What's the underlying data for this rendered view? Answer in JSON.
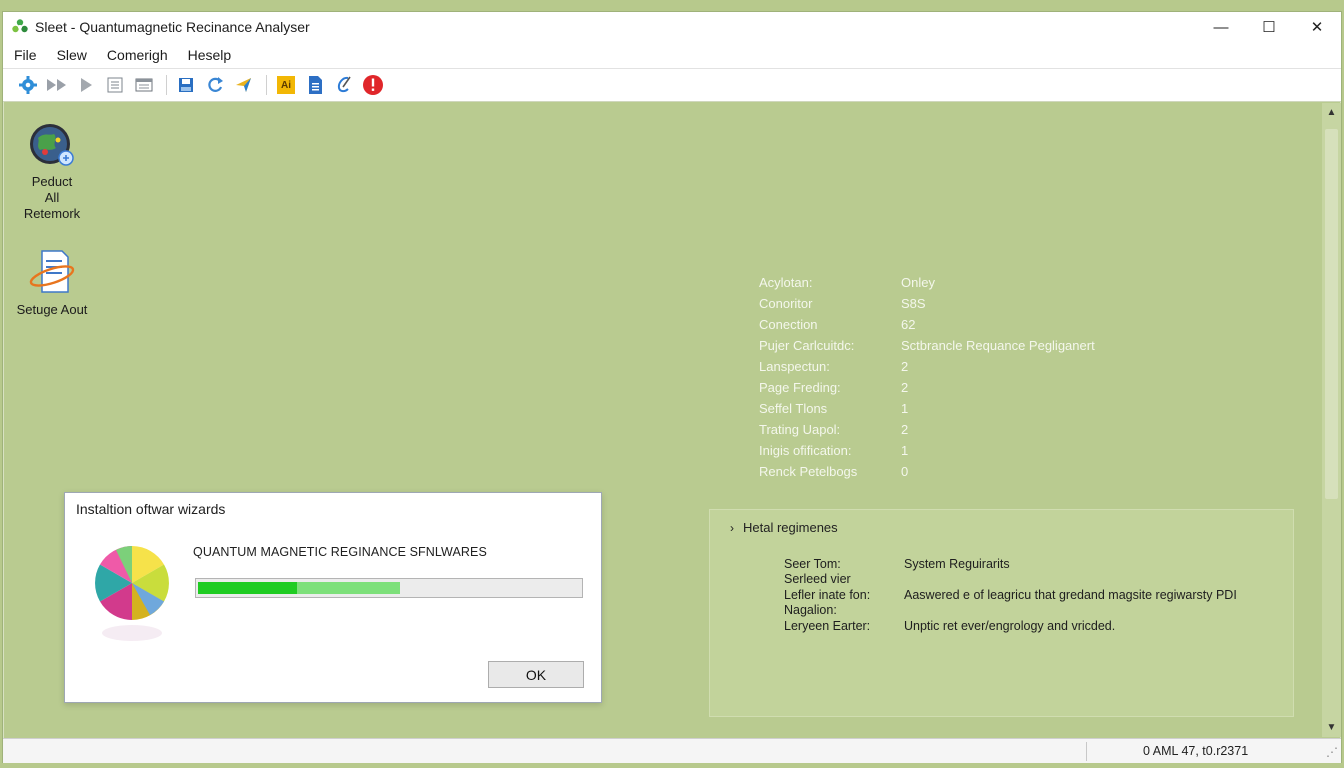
{
  "window": {
    "title": "Sleet - Quantumagnetic Recinance Analyser",
    "controls": {
      "minimize": "—",
      "maximize": "☐",
      "close": "✕"
    }
  },
  "menu": [
    "File",
    "Slew",
    "Comerigh",
    "Heselp"
  ],
  "toolbar": {
    "icons": [
      "settings-icon",
      "fast-forward-icon",
      "play-icon",
      "document-list-icon",
      "window-icon",
      "save-icon",
      "refresh-icon",
      "navigate-icon",
      "text-icon",
      "document-icon",
      "edit-icon",
      "error-icon"
    ],
    "text_icon_label": "Ai"
  },
  "desktop": {
    "icons": [
      {
        "label": "Peduct\nAll\nRetemork",
        "icon": "globe-network-icon"
      },
      {
        "label": "Setuge Aout",
        "icon": "setup-document-icon"
      }
    ]
  },
  "properties": [
    {
      "key": "Acylotan:",
      "value": "Onley"
    },
    {
      "key": "Conoritor",
      "value": "S8S"
    },
    {
      "key": "Conection",
      "value": "62"
    },
    {
      "key": "Pujer Carlcuitdc:",
      "value": "Sctbrancle Requance Pegliganert"
    },
    {
      "key": "Lanspectun:",
      "value": "2"
    },
    {
      "key": "Page Freding:",
      "value": "2"
    },
    {
      "key": "Seffel Tlons",
      "value": "1"
    },
    {
      "key": "Trating Uapol:",
      "value": "2"
    },
    {
      "key": "Inigis ofification:",
      "value": "1"
    },
    {
      "key": "Renck Petelbogs",
      "value": "0"
    }
  ],
  "requirements": {
    "header": "Hetal regimenes",
    "rows": [
      {
        "key": "Seer Tom:\nSerleed vier",
        "value": "System Reguirarits"
      },
      {
        "key": "Lefler inate fon:\nNagalion:",
        "value": "Aaswered e of leagricu that gredand magsite regiwarsty PDI"
      },
      {
        "key": "Leryeen Earter:",
        "value": "Unptic ret ever/engrology and vricded."
      }
    ]
  },
  "dialog": {
    "title": "Instaltion oftwar wizards",
    "heading": "QUANTUM MAGNETIC REGINANCE SFNLWARES",
    "progress_light": 0.53,
    "progress_dark": 0.26,
    "ok_label": "OK"
  },
  "statusbar": {
    "text": "0 AML 47, t0.r2371"
  },
  "colors": {
    "background": "#b9cb90",
    "progress_dark": "#1fcc22",
    "progress_light": "#7de07a"
  }
}
